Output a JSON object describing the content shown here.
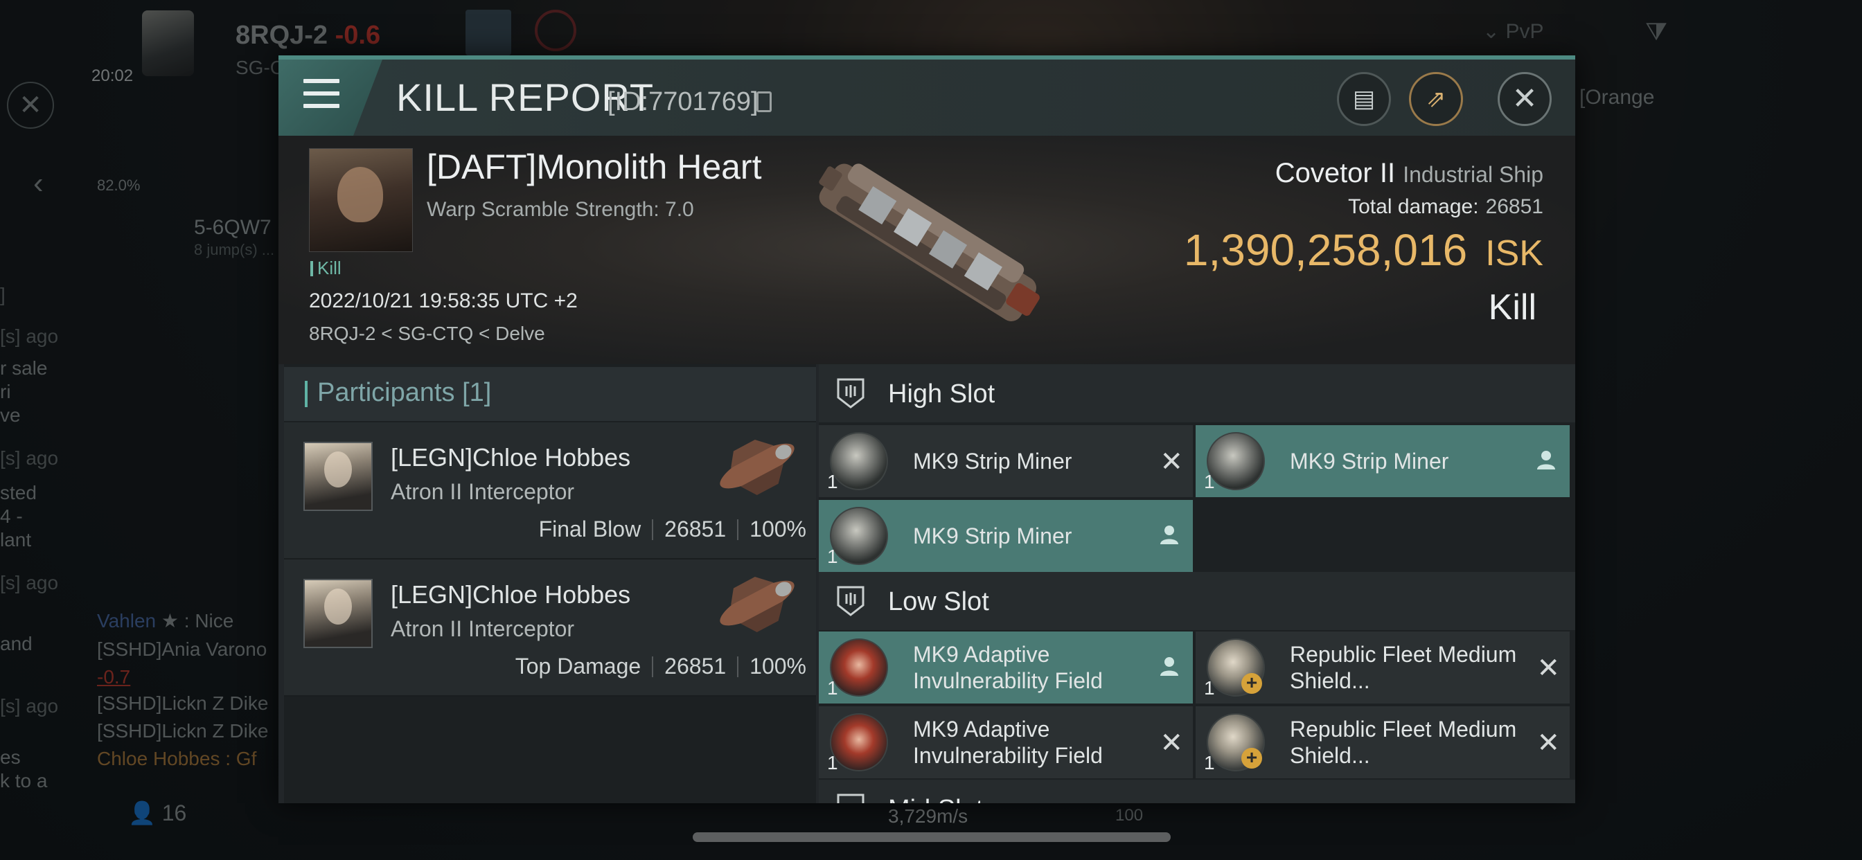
{
  "hud": {
    "system": "8RQJ-2",
    "security": "-0.6",
    "sub": "SG-C",
    "time": "20:02",
    "pvp_filter": "PvP",
    "stat_pct": "82.0%",
    "nav_target": "5-6QW7",
    "nav_jumps": "8 jump(s) ...",
    "orange_text": "[Orange",
    "chat": [
      {
        "who": "Vahlen",
        "msg": ": Nice"
      },
      {
        "who": "",
        "msg": "[SSHD]Ania Varono"
      },
      {
        "who": "",
        "msg": "-0.7"
      },
      {
        "who": "",
        "msg": "[SSHD]Lickn Z Dike"
      },
      {
        "who": "",
        "msg": "[SSHD]Lickn Z Dike"
      },
      {
        "who": "",
        "msg": "Chloe Hobbes : Gf"
      }
    ],
    "side_lines": [
      "]",
      "[s] ago",
      "r sale",
      "ri",
      "ve",
      "[s] ago",
      "sted",
      "4 -",
      "lant",
      "[s] ago",
      "and",
      "[s] ago",
      "es",
      "k to a"
    ],
    "member_count": "16",
    "speed": "3,729m/s",
    "speed_max": "100"
  },
  "modal": {
    "title": "KILL REPORT",
    "id_text": "[ID:7701769]",
    "colors": {
      "accent": "#4d8a82",
      "isk": "#e8b868",
      "highlight": "#4a7a74"
    }
  },
  "victim": {
    "name": "[DAFT]Monolith Heart",
    "warp": "Warp Scramble Strength: 7.0",
    "kill_tag": "Kill",
    "date": "2022/10/21 19:58:35 UTC +2",
    "location": "8RQJ-2 < SG-CTQ < Delve",
    "ship": "Covetor II",
    "ship_class": "Industrial Ship",
    "total_damage_label": "Total damage:",
    "total_damage": "26851",
    "isk_value": "1,390,258,016",
    "isk_unit": "ISK",
    "result": "Kill"
  },
  "participants": {
    "title": "Participants [1]",
    "rows": [
      {
        "name": "[LEGN]Chloe Hobbes",
        "ship": "Atron II Interceptor",
        "role": "Final Blow",
        "damage": "26851",
        "pct": "100%"
      },
      {
        "name": "[LEGN]Chloe Hobbes",
        "ship": "Atron II Interceptor",
        "role": "Top Damage",
        "damage": "26851",
        "pct": "100%"
      }
    ]
  },
  "fitting": {
    "high_title": "High Slot",
    "low_title": "Low Slot",
    "mid_title": "Mid Slot",
    "high": [
      {
        "name": "MK9 Strip Miner",
        "qty": "1",
        "state": "destroyed"
      },
      {
        "name": "MK9 Strip Miner",
        "qty": "1",
        "state": "dropped"
      },
      {
        "name": "MK9 Strip Miner",
        "qty": "1",
        "state": "dropped"
      }
    ],
    "low": [
      {
        "name": "MK9 Adaptive Invulnerability Field",
        "qty": "1",
        "state": "dropped"
      },
      {
        "name": "Republic Fleet Medium Shield...",
        "qty": "1",
        "state": "destroyed"
      },
      {
        "name": "MK9 Adaptive Invulnerability Field",
        "qty": "1",
        "state": "destroyed"
      },
      {
        "name": "Republic Fleet Medium Shield...",
        "qty": "1",
        "state": "destroyed"
      }
    ]
  }
}
